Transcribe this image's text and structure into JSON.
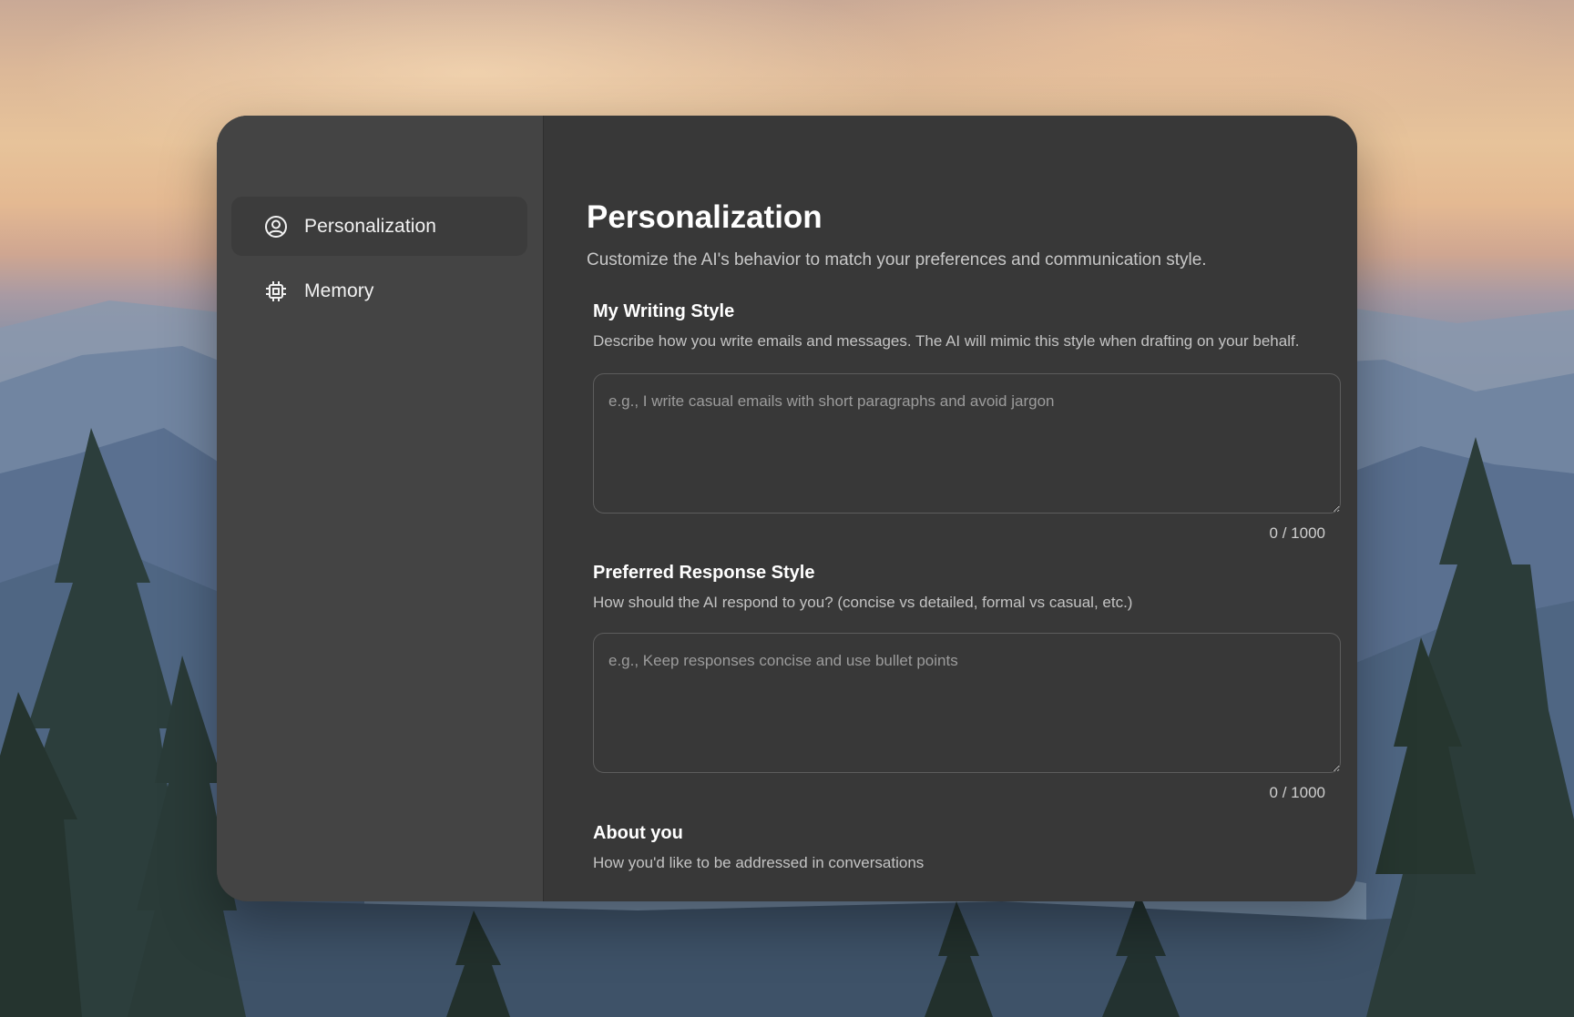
{
  "colors": {
    "window_bg": "#383838",
    "sidebar_bg": "#444444",
    "active_item_bg": "#3c3c3c",
    "text_primary": "#ffffff",
    "text_secondary": "#c4c4c4"
  },
  "sidebar": {
    "items": [
      {
        "label": "Personalization",
        "icon": "user-circle-icon",
        "active": true
      },
      {
        "label": "Memory",
        "icon": "chip-icon",
        "active": false
      }
    ]
  },
  "main": {
    "title": "Personalization",
    "subtitle": "Customize the AI's behavior to match your preferences and communication style.",
    "sections": [
      {
        "title": "My Writing Style",
        "description": "Describe how you write emails and messages. The AI will mimic this style when drafting on your behalf.",
        "placeholder": "e.g., I write casual emails with short paragraphs and avoid jargon",
        "value": "",
        "counter": "0 / 1000"
      },
      {
        "title": "Preferred Response Style",
        "description": "How should the AI respond to you? (concise vs detailed, formal vs casual, etc.)",
        "placeholder": "e.g., Keep responses concise and use bullet points",
        "value": "",
        "counter": "0 / 1000"
      },
      {
        "title": "About you",
        "description": "How you'd like to be addressed in conversations"
      }
    ]
  }
}
